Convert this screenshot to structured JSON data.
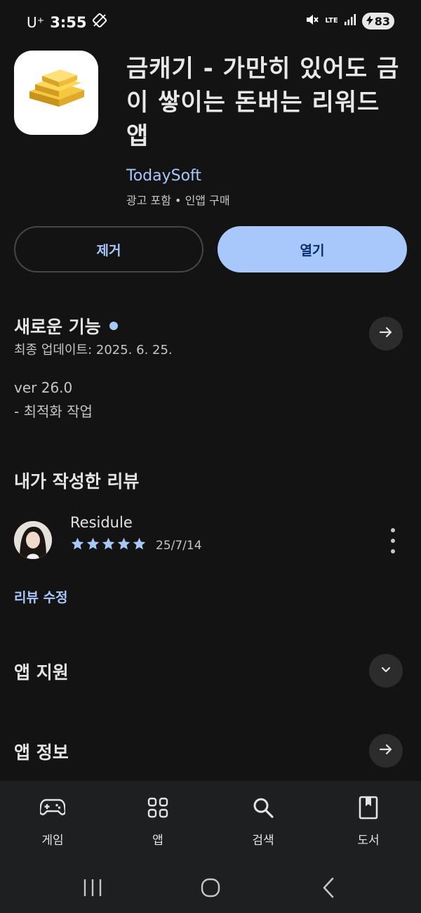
{
  "status_bar": {
    "carrier": "U⁺",
    "time": "3:55",
    "network": "LTE",
    "battery": "83"
  },
  "app": {
    "title": "금캐기 - 가만히 있어도 금이 쌓이는 돈버는 리워드 앱",
    "developer": "TodaySoft",
    "meta": "광고 포함 • 인앱 구매",
    "remove_label": "제거",
    "open_label": "열기"
  },
  "whats_new": {
    "title": "새로운 기능",
    "updated": "최종 업데이트: 2025. 6. 25.",
    "version": "ver 26.0",
    "notes": "- 최적화 작업"
  },
  "my_review": {
    "title": "내가 작성한 리뷰",
    "reviewer": "Residule",
    "rating": 5,
    "date": "25/7/14",
    "edit_label": "리뷰 수정"
  },
  "sections": {
    "support": "앱 지원",
    "info": "앱 정보"
  },
  "bottom_nav": {
    "items": [
      {
        "label": "게임",
        "icon": "gamepad-icon"
      },
      {
        "label": "앱",
        "icon": "apps-grid-icon"
      },
      {
        "label": "검색",
        "icon": "search-icon"
      },
      {
        "label": "도서",
        "icon": "book-icon"
      }
    ]
  },
  "colors": {
    "background": "#131313",
    "accent": "#a8c7fa",
    "surface": "#1e1f20"
  }
}
